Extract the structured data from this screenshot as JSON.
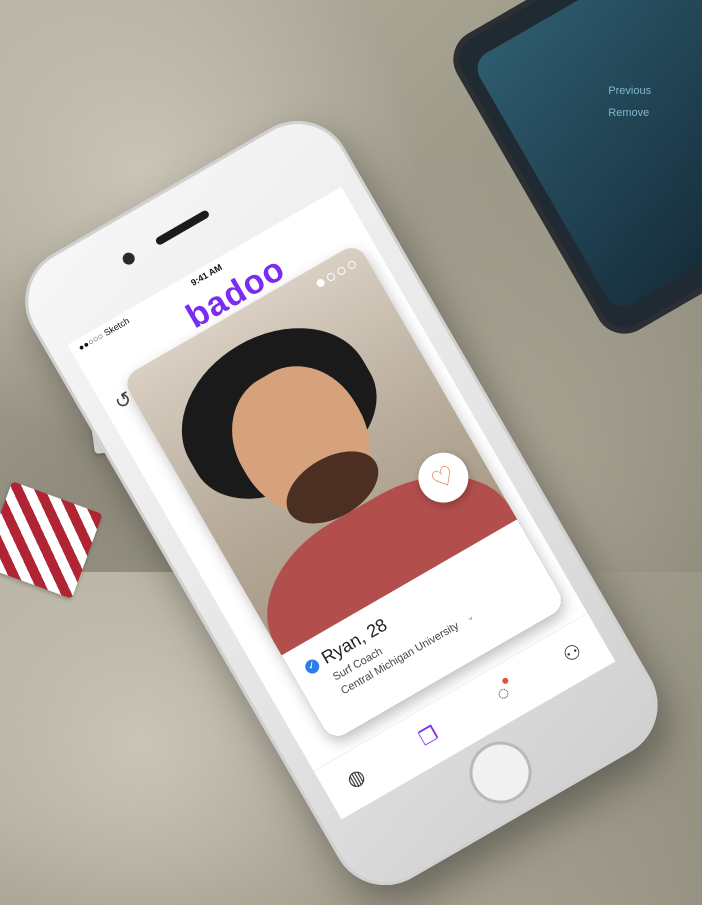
{
  "status_bar": {
    "carrier": "●●○○○ Sketch",
    "time": "9:41 AM"
  },
  "brand": {
    "name": "badoo"
  },
  "profile": {
    "name": "Ryan, 28",
    "job": "Surf Coach",
    "school": "Central Michigan University",
    "photo_count": 4,
    "active_photo": 1
  },
  "second_phone": {
    "menu_items": [
      "Previous",
      "Remove"
    ]
  },
  "icons": {
    "undo": "undo-icon",
    "like": "heart-like-icon",
    "verified": "verified-check-icon",
    "nav": [
      "globe-icon",
      "encounters-cards-icon",
      "chat-bubble-icon",
      "profile-icon"
    ]
  },
  "colors": {
    "brand": "#7b2cf0",
    "like": "#ef6a3c",
    "verified": "#2f7ee6",
    "badge": "#ef4b3c"
  }
}
